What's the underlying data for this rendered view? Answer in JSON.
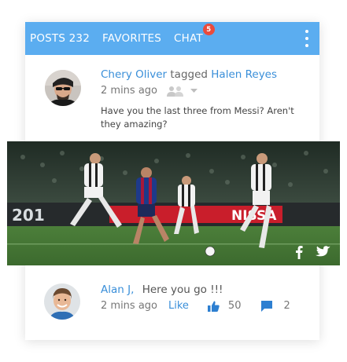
{
  "tabs": [
    {
      "label": "POSTS 232"
    },
    {
      "label": "FAVORITES"
    },
    {
      "label": "CHAT",
      "badge": "5"
    }
  ],
  "colors": {
    "header": "#5badf0",
    "link": "#3a8fd9",
    "badge": "#ea4b3c"
  },
  "post": {
    "author": "Chery Oliver",
    "action": "tagged",
    "tagged_user": "Halen Reyes",
    "time": "2 mins ago",
    "audience_icon": "group-icon",
    "text": "Have you the last three from Messi? Aren't they amazing?",
    "photo_sign": "NISSA",
    "photo_number": "201",
    "share_icons": [
      "facebook-icon",
      "twitter-icon"
    ]
  },
  "reply": {
    "author": "Alan J,",
    "text": "Here you go !!!",
    "time": "2 mins ago",
    "like_label": "Like",
    "likes": "50",
    "comments": "2"
  }
}
